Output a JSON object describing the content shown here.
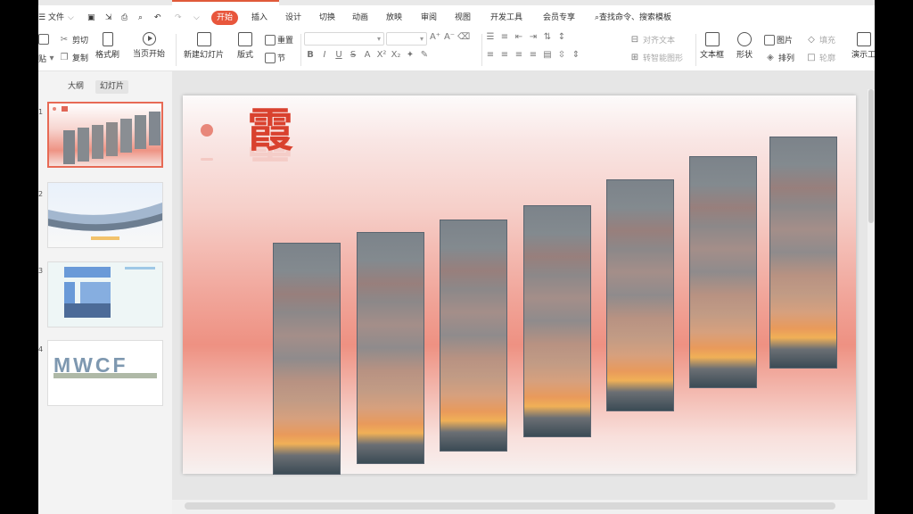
{
  "menu": {
    "file": "文件",
    "tabs": [
      "开始",
      "插入",
      "设计",
      "切换",
      "动画",
      "放映",
      "审阅",
      "视图",
      "开发工具",
      "会员专享"
    ],
    "active_tab": "开始",
    "search": "查找命令、搜索模板"
  },
  "ribbon": {
    "paste": "贴",
    "cut": "剪切",
    "copy": "复制",
    "format_painter": "格式刷",
    "from_current": "当页开始",
    "new_slide": "新建幻灯片",
    "layout": "版式",
    "reset": "重置",
    "section": "节",
    "align_text": "对齐文本",
    "convert_smartart": "转智能图形",
    "textbox": "文本框",
    "shape": "形状",
    "picture": "图片",
    "fill": "填充",
    "arrange": "排列",
    "outline": "轮廓",
    "presentation_tools": "演示工"
  },
  "panel": {
    "outline_tab": "大纲",
    "slides_tab": "幻灯片",
    "numbers": [
      "1",
      "2",
      "3",
      "4"
    ],
    "thumb4_text": "MWCF"
  },
  "slide": {
    "title": "霞",
    "panel_count": 7
  },
  "colors": {
    "accent": "#e8563c",
    "title": "#d9412e"
  }
}
